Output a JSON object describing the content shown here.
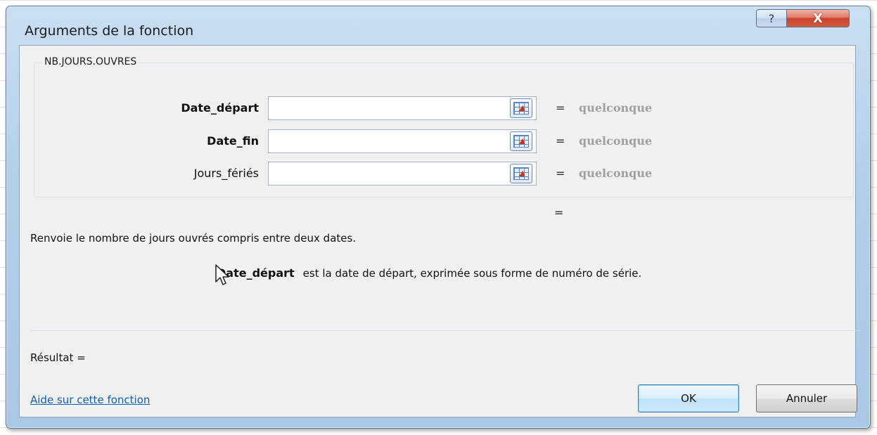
{
  "window": {
    "title": "Arguments de la fonction",
    "help_button": "?",
    "close_button": "X"
  },
  "function": {
    "name": "NB.JOURS.OUVRES",
    "arguments": [
      {
        "label": "Date_départ",
        "bold": true,
        "value": "",
        "equals": "=",
        "result": "quelconque"
      },
      {
        "label": "Date_fin",
        "bold": true,
        "value": "",
        "equals": "=",
        "result": "quelconque"
      },
      {
        "label": "Jours_fériés",
        "bold": false,
        "value": "",
        "equals": "=",
        "result": "quelconque"
      }
    ],
    "result_equals": "=",
    "description": "Renvoie le nombre de jours ouvrés compris entre deux dates.",
    "argument_help": {
      "name": "Date_départ",
      "text": "est la date de départ, exprimée sous forme de numéro de série."
    }
  },
  "footer": {
    "result_label": "Résultat =",
    "help_link": "Aide sur cette fonction",
    "ok_label": "OK",
    "cancel_label": "Annuler"
  },
  "colors": {
    "title_bar": "#b3d0ea",
    "close_button": "#c8432b",
    "link": "#0f5fb3",
    "placeholder_result": "#a0a0a0"
  }
}
